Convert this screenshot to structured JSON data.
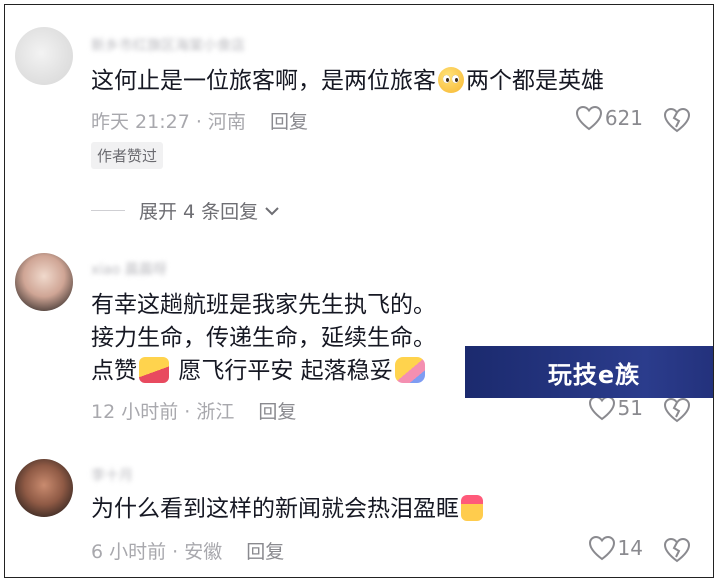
{
  "comments": [
    {
      "username": "新乡市红旗区海棠小食店",
      "text_before": "这何止是一位旅客啊，是两位旅客",
      "emoji": "pleading-face-icon",
      "text_after": "两个都是英雄",
      "time": "昨天 21:27",
      "location": "河南",
      "reply_label": "回复",
      "likes": "621",
      "badge": "作者赞过",
      "expand_label": "展开 4 条回复"
    },
    {
      "username": "xiao 晨晨呀",
      "lines": [
        "有幸这趟航班是我家先生执飞的。",
        "接力生命，传递生命，延续生命。"
      ],
      "line3_a": "点赞",
      "line3_b": "愿飞行平安 起落稳妥",
      "time": "12 小时前",
      "location": "浙江",
      "reply_label": "回复",
      "likes": "51"
    },
    {
      "username": "李十月",
      "text": "为什么看到这样的新闻就会热泪盈眶",
      "time": "6 小时前",
      "location": "安徽",
      "reply_label": "回复",
      "likes": "14"
    }
  ],
  "watermark": {
    "logo_text": "玩技e族"
  },
  "colors": {
    "text": "#161823",
    "meta": "#a8a8ad",
    "watermark_bg": "#1b2a6e"
  }
}
